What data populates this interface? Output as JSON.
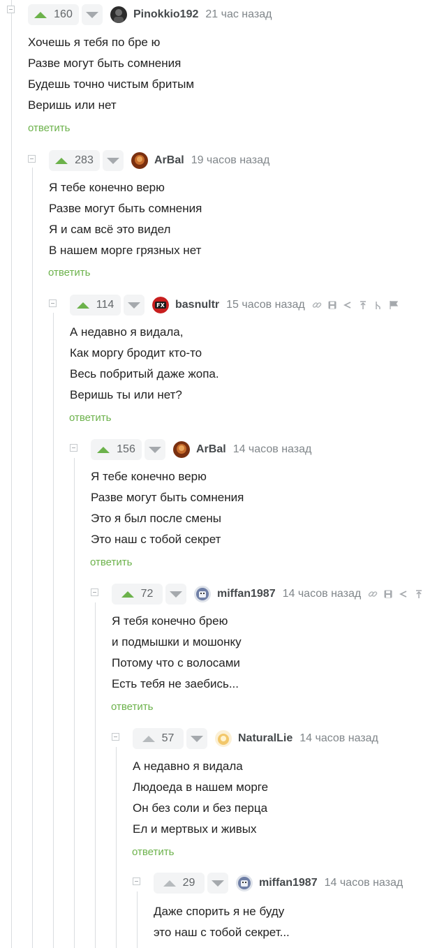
{
  "reply_label": "ответить",
  "comments": [
    {
      "votes": "160",
      "username": "Pinokkio192",
      "time": "21 час назад",
      "lines": [
        "Хочешь я тебя по бре ю",
        "Разве могут быть сомнения",
        "Будешь точно чистым бритым",
        "Веришь или нет"
      ]
    },
    {
      "votes": "283",
      "username": "ArBal",
      "time": "19 часов назад",
      "lines": [
        "Я тебе конечно верю",
        "Разве могут быть сомнения",
        "Я и сам всё это видел",
        "В нашем морге грязных нет"
      ]
    },
    {
      "votes": "114",
      "username": "basnultr",
      "time": "15 часов назад",
      "lines": [
        "А недавно я видала,",
        "Как моргу бродит кто-то",
        "Весь побритый даже жопа.",
        "Веришь ты или нет?"
      ]
    },
    {
      "votes": "156",
      "username": "ArBal",
      "time": "14 часов назад",
      "lines": [
        "Я тебе конечно верю",
        "Разве могут быть сомнения",
        "Это я был после смены",
        "Это наш с тобой секрет"
      ]
    },
    {
      "votes": "72",
      "username": "miffan1987",
      "time": "14 часов назад",
      "lines": [
        "Я тебя конечно брею",
        "и подмышки и мошонку",
        "Потому что с волосами",
        "Есть тебя не заебись..."
      ]
    },
    {
      "votes": "57",
      "username": "NaturalLie",
      "time": "14 часов назад",
      "lines": [
        "А недавно я видала",
        "Людоеда в нашем морге",
        "Он без соли и без перца",
        "Ел и мертвых и живых"
      ]
    },
    {
      "votes": "29",
      "username": "miffan1987",
      "time": "14 часов назад",
      "lines": [
        "Даже спорить я не буду",
        "это наш с тобой секрет..."
      ]
    }
  ],
  "icons": {
    "vote_up": "arrow-up-icon",
    "vote_down": "arrow-down-icon",
    "collapse": "collapse-icon",
    "link": "link-icon",
    "save": "save-icon",
    "share": "share-icon",
    "to_parent": "to-parent-icon",
    "branch": "branch-icon",
    "report": "flag-icon"
  },
  "colors": {
    "upvote_active": "#6cb24b",
    "upvote_muted": "#b6babd",
    "reply_link": "#6cb24b",
    "time_text": "#80868a",
    "tree_line": "#dadde0"
  }
}
